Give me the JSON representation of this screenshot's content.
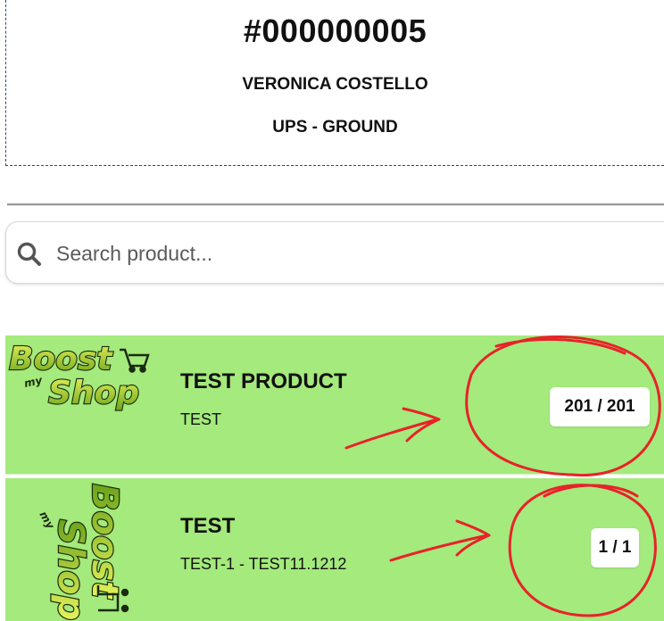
{
  "order": {
    "number": "#000000005",
    "customer": "VERONICA COSTELLO",
    "shipping": "UPS - GROUND"
  },
  "search": {
    "placeholder": "Search product...",
    "value": ""
  },
  "products": [
    {
      "name": "TEST PRODUCT",
      "sku": "TEST",
      "qty": "201 / 201",
      "logo": "boost-my-shop-logo"
    },
    {
      "name": "TEST",
      "sku": "TEST-1 - TEST11.1212",
      "qty": "1 / 1",
      "logo": "boost-my-shop-logo"
    }
  ],
  "colors": {
    "row_background": "#a4ea7c",
    "annotation_red": "#e8222a",
    "header_border": "#2d4b6b"
  }
}
